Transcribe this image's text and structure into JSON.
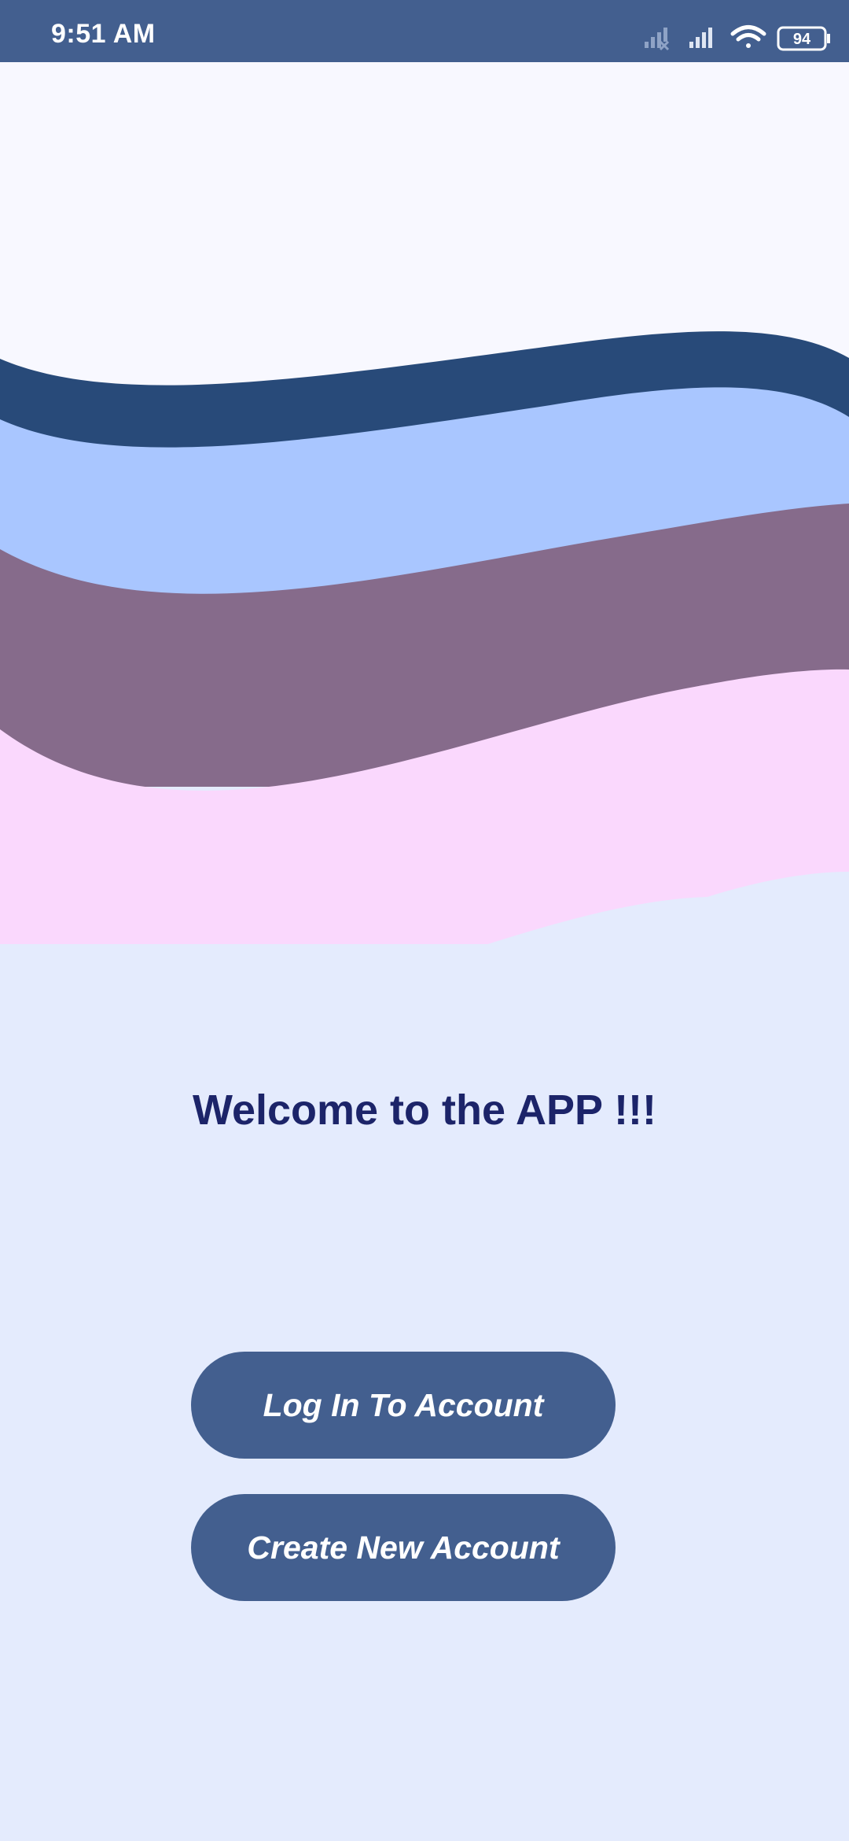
{
  "status_bar": {
    "time": "9:51 AM",
    "battery_level": "94",
    "icons": [
      "signal-off-icon",
      "signal-icon",
      "wifi-icon",
      "battery-icon"
    ]
  },
  "welcome": {
    "title": "Welcome to the APP !!!"
  },
  "buttons": {
    "login_label": "Log In To Account",
    "create_label": "Create New Account"
  },
  "colors": {
    "status_bar": "#435f8f",
    "background": "#e4ebfd",
    "wave_dark_blue": "#284a79",
    "wave_light_blue": "#a9c6ff",
    "wave_mauve": "#866b8b",
    "wave_pink": "#fad8fd",
    "title_text": "#1c2469",
    "button": "#435f8f"
  }
}
